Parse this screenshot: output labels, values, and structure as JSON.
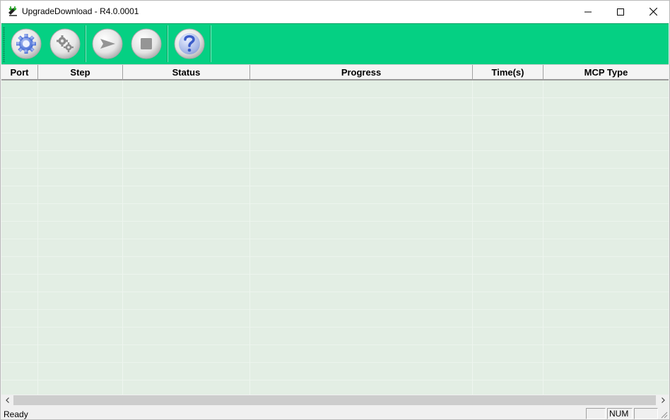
{
  "window": {
    "title": "UpgradeDownload - R4.0.0001",
    "controls": [
      "minimize",
      "maximize",
      "close"
    ]
  },
  "toolbar": {
    "buttons": [
      {
        "icon": "settings-gear-icon"
      },
      {
        "icon": "advanced-settings-gears-icon"
      },
      {
        "icon": "start-arrow-icon"
      },
      {
        "icon": "stop-square-icon"
      },
      {
        "icon": "help-question-icon"
      }
    ],
    "background": "#05d083"
  },
  "table": {
    "columns": [
      "Port",
      "Step",
      "Status",
      "Progress",
      "Time(s)",
      "MCP Type"
    ],
    "rows": [],
    "row_background": "#e3eee4"
  },
  "statusbar": {
    "text": "Ready",
    "panes": [
      "",
      "NUM",
      ""
    ]
  }
}
